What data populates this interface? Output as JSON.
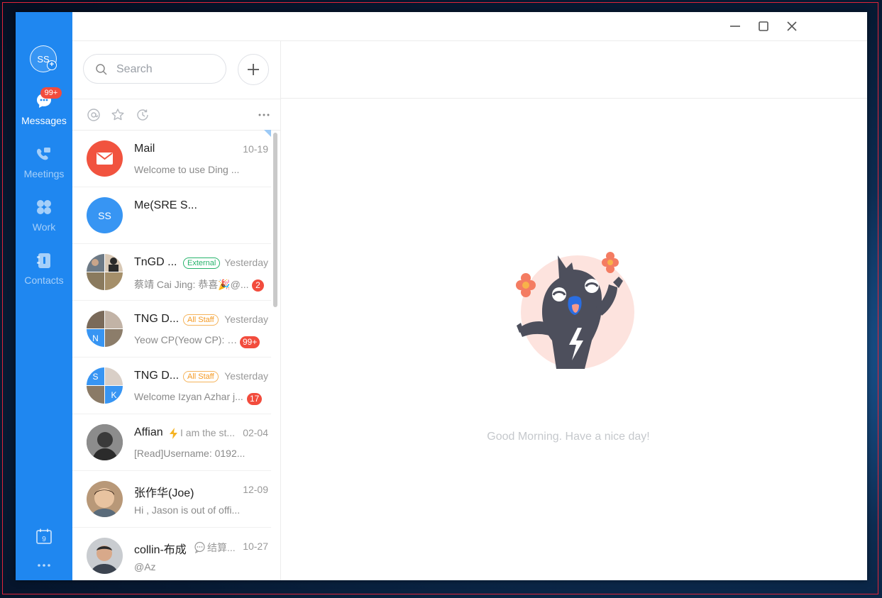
{
  "rail": {
    "avatar_text": "SS",
    "messages_badge": "99+",
    "items": [
      {
        "label": "Messages",
        "icon": "chat-bubble-icon",
        "active": true
      },
      {
        "label": "Meetings",
        "icon": "video-call-icon",
        "active": false
      },
      {
        "label": "Work",
        "icon": "apps-grid-icon",
        "active": false
      },
      {
        "label": "Contacts",
        "icon": "contacts-book-icon",
        "active": false
      }
    ],
    "calendar_day": "9",
    "accent_color": "#1f87f0"
  },
  "search": {
    "placeholder": "Search"
  },
  "conversations": [
    {
      "name": "Mail",
      "time": "10-19",
      "preview": "Welcome to use Ding ...",
      "avatar": "mail"
    },
    {
      "name": "Me(SRE S...",
      "time": "",
      "preview": "",
      "avatar_text": "SS"
    },
    {
      "name": "TnGD ...",
      "tag": "External",
      "time": "Yesterday",
      "preview": "蔡靖 Cai Jing: 恭喜🎉@...",
      "unread": "2"
    },
    {
      "name": "TNG D...",
      "tag": "All Staff",
      "time": "Yesterday",
      "preview": "Yeow CP(Yeow CP): D...",
      "unread": "99+"
    },
    {
      "name": "TNG D...",
      "tag": "All Staff",
      "time": "Yesterday",
      "preview": "Welcome Izyan Azhar j...",
      "unread": "17"
    },
    {
      "name": "Affian",
      "status": "I am the st...",
      "time": "02-04",
      "preview": "[Read]Username: 0192..."
    },
    {
      "name": "张作华(Joe)",
      "time": "12-09",
      "preview": "Hi , Jason is out of offi..."
    },
    {
      "name": "collin-布成",
      "status": "结算...",
      "time": "10-27",
      "preview": "@Az"
    }
  ],
  "main": {
    "greeting": "Good Morning. Have a nice day!"
  }
}
